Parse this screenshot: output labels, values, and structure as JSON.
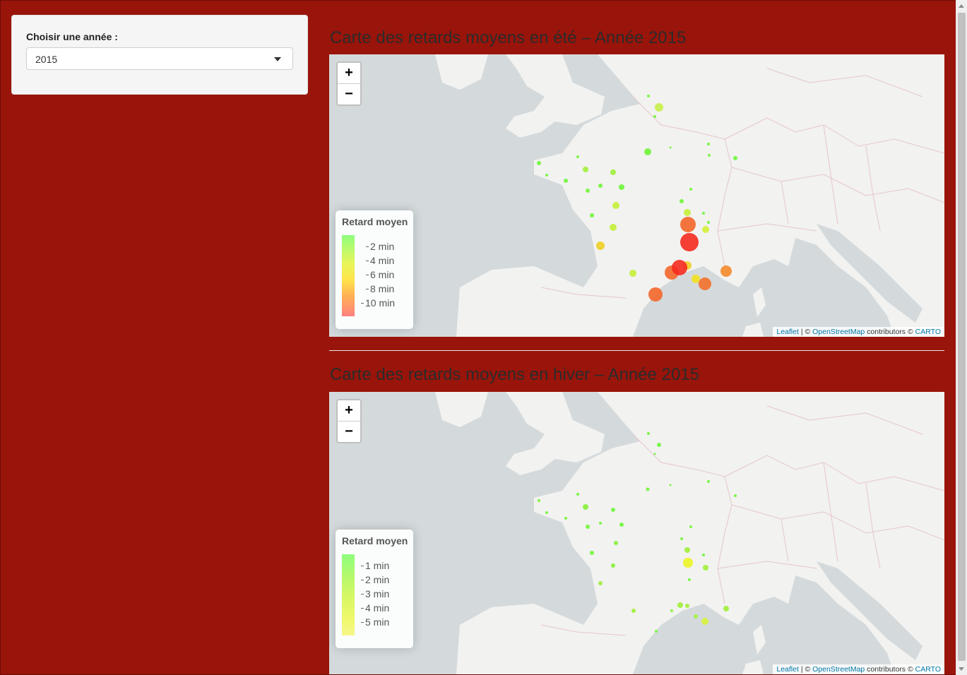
{
  "sidebar": {
    "label": "Choisir une année :",
    "selected_year": "2015"
  },
  "maps": [
    {
      "title": "Carte des retards moyens en été – Année 2015",
      "legend_title": "Retard moyen",
      "legend_ticks": [
        "2 min",
        "4 min",
        "6 min",
        "8 min",
        "10 min"
      ],
      "legend_colors": [
        "#8fff7f",
        "#e8f55a",
        "#ffe44a",
        "#ffb055",
        "#ff8080"
      ]
    },
    {
      "title": "Carte des retards moyens en hiver – Année 2015",
      "legend_title": "Retard moyen",
      "legend_ticks": [
        "1 min",
        "2 min",
        "3 min",
        "4 min",
        "5 min"
      ],
      "legend_colors": [
        "#8fff7f",
        "#b9f86a",
        "#d9f765",
        "#eff86a",
        "#f6f78a"
      ]
    }
  ],
  "zoom": {
    "in": "+",
    "out": "−"
  },
  "attribution": {
    "leaflet": "Leaflet",
    "sep": " | © ",
    "osm": "OpenStreetMap",
    "contrib": " contributors © ",
    "carto": "CARTO"
  }
}
